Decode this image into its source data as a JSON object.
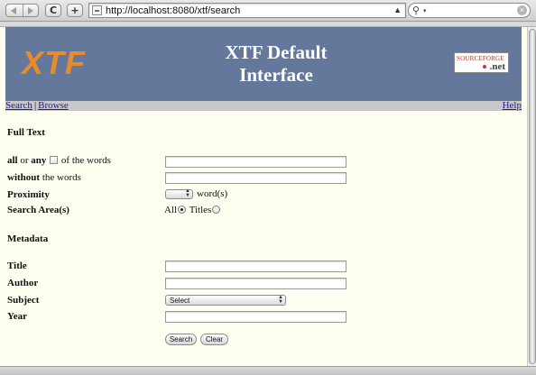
{
  "browser": {
    "url": "http://localhost:8080/xtf/search",
    "reload_glyph": "C",
    "add_glyph": "+",
    "search_placeholder": ""
  },
  "banner": {
    "logo": "XTF",
    "title_line1": "XTF Default",
    "title_line2": "Interface",
    "badge_top": "SOURCEFORGE",
    "badge_net": ".net"
  },
  "nav": {
    "search": "Search",
    "separator": "|",
    "browse": "Browse",
    "help": "Help"
  },
  "form": {
    "full_text_heading": "Full Text",
    "all_label": "all",
    "or_label": " or ",
    "any_label": "any",
    "of_words": " of the words",
    "without_label": "without",
    "without_rest": " the words",
    "proximity_label": "Proximity",
    "proximity_unit": "word(s)",
    "search_area_label": "Search Area(s)",
    "area_all": "All",
    "area_titles": "Titles",
    "metadata_heading": "Metadata",
    "title_label": "Title",
    "author_label": "Author",
    "subject_label": "Subject",
    "subject_select": "Select",
    "year_label": "Year",
    "search_button": "Search",
    "clear_button": "Clear"
  }
}
